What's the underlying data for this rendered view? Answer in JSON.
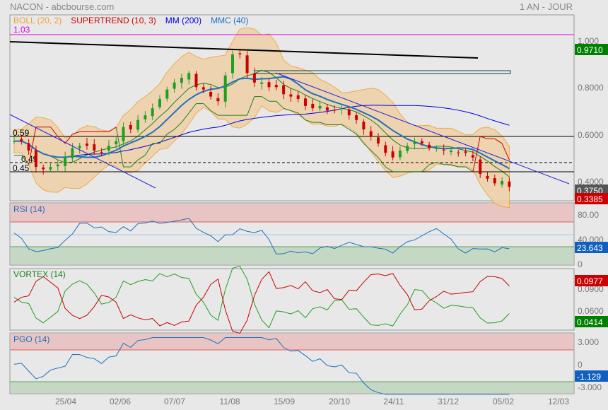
{
  "header": {
    "title": "NACON - abcbourse.com",
    "period": "1 AN - JOUR"
  },
  "legend": [
    {
      "label": "BOLL (20, 2)",
      "color": "#f0a030"
    },
    {
      "label": "SUPERTREND (10, 3)",
      "color": "#cc0000"
    },
    {
      "label": "MM (200)",
      "color": "#0000dd"
    },
    {
      "label": "MMC (40)",
      "color": "#2070c0"
    }
  ],
  "chart_data": {
    "type": "candlestick",
    "price_ylim": [
      0.36,
      1.03
    ],
    "price_ticks": [
      "1.000",
      "0.8000",
      "0.6000",
      "0.4000"
    ],
    "x_ticks": [
      "25/04",
      "02/06",
      "07/07",
      "11/08",
      "15/09",
      "20/10",
      "24/11",
      "31/12",
      "05/02",
      "12/03"
    ],
    "closes": [
      0.57,
      0.57,
      0.53,
      0.46,
      0.45,
      0.46,
      0.47,
      0.5,
      0.54,
      0.55,
      0.55,
      0.53,
      0.52,
      0.55,
      0.57,
      0.63,
      0.62,
      0.66,
      0.68,
      0.71,
      0.75,
      0.79,
      0.82,
      0.84,
      0.86,
      0.8,
      0.79,
      0.76,
      0.74,
      0.85,
      0.94,
      0.94,
      0.86,
      0.82,
      0.82,
      0.8,
      0.8,
      0.77,
      0.76,
      0.75,
      0.72,
      0.71,
      0.72,
      0.7,
      0.7,
      0.71,
      0.68,
      0.66,
      0.62,
      0.59,
      0.56,
      0.52,
      0.5,
      0.53,
      0.55,
      0.57,
      0.56,
      0.54,
      0.54,
      0.53,
      0.53,
      0.52,
      0.52,
      0.5,
      0.43,
      0.41,
      0.39,
      0.4,
      0.375
    ],
    "levels": [
      {
        "label": "1.03",
        "value": 1.03,
        "color": "#e000e0"
      },
      {
        "label": "0.59",
        "value": 0.59,
        "style": "solid"
      },
      {
        "label": "0.49",
        "value": 0.485,
        "style": "dashed"
      },
      {
        "label": "0.45",
        "value": 0.45,
        "style": "solid"
      }
    ],
    "last_labels": [
      {
        "text": "0.9710",
        "value": 0.971,
        "color": "#008000"
      },
      {
        "text": "0.3750",
        "value": 0.375,
        "color": "#555555"
      },
      {
        "text": "0.3385",
        "value": 0.3385,
        "color": "#cc0000"
      }
    ],
    "rsi": {
      "title": "RSI (14)",
      "ticks": [
        "80.00",
        "40.000",
        "0"
      ],
      "last": "23.643",
      "zones": [
        70,
        30
      ]
    },
    "vortex": {
      "title": "VORTEX (14)",
      "ticks": [
        "0.0900",
        "0.0600"
      ],
      "last_plus": "0.0977",
      "last_minus": "0.0414"
    },
    "pgo": {
      "title": "PGO (14)",
      "ticks": [
        "3.000",
        "0",
        "-3.000"
      ],
      "last": "-1.129",
      "zones": [
        2,
        -2
      ]
    }
  }
}
